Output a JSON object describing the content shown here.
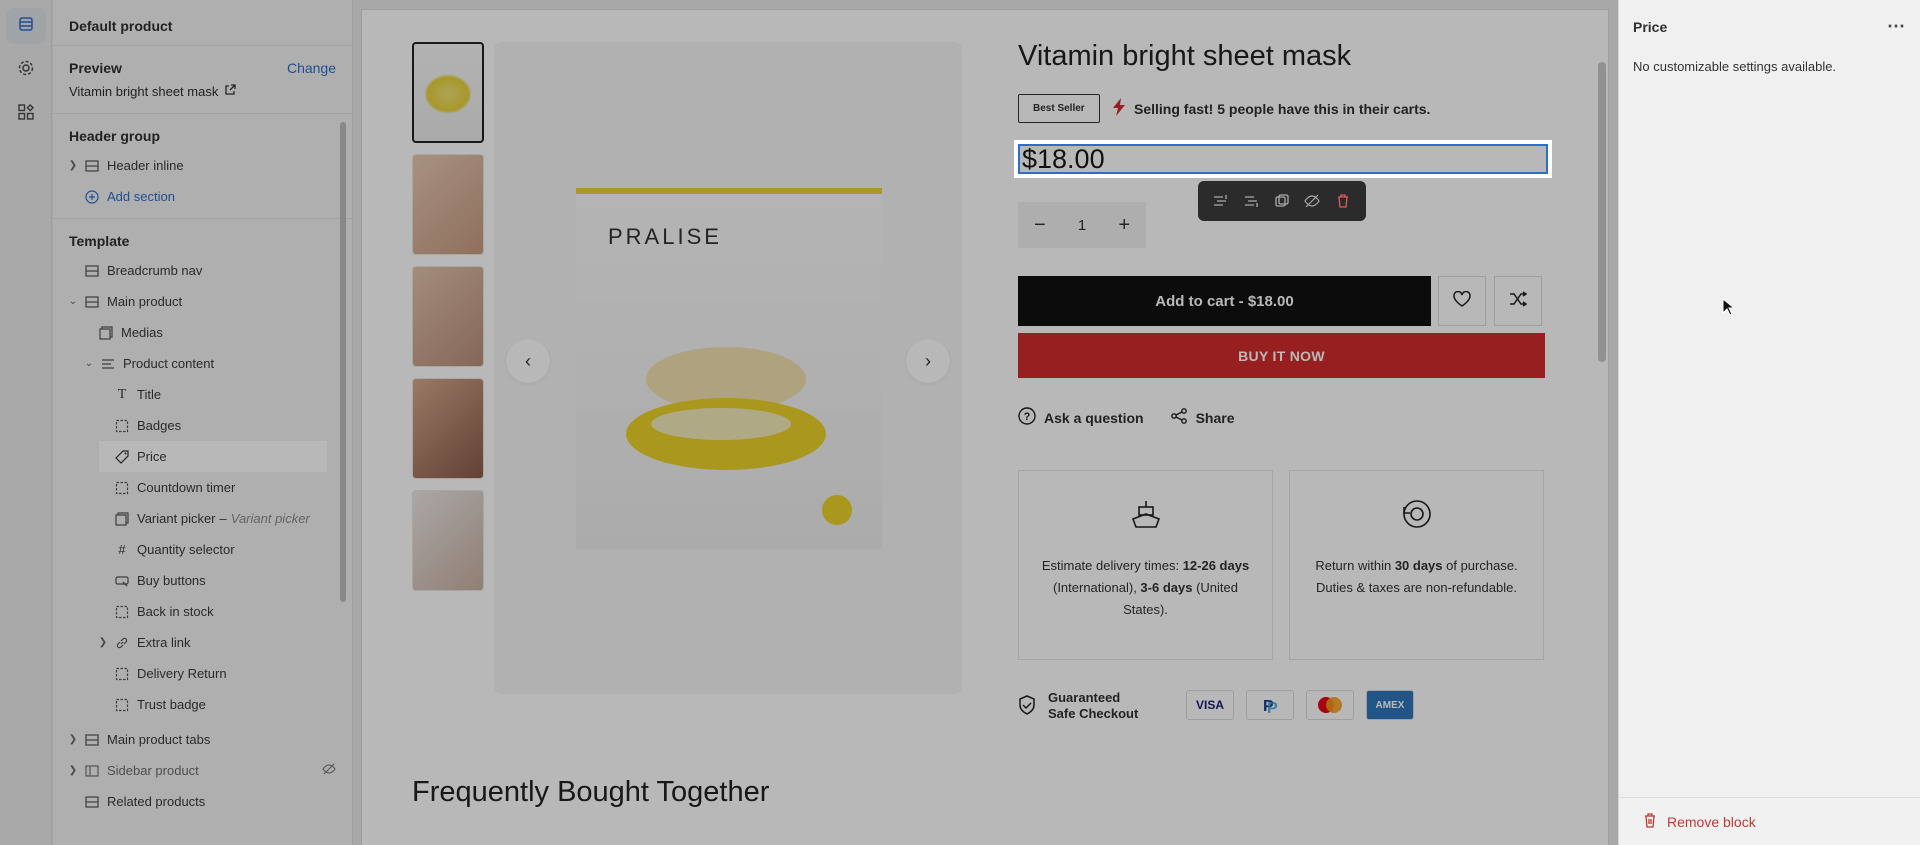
{
  "rail": {
    "items": [
      {
        "name": "sections-icon",
        "active": true
      },
      {
        "name": "settings-icon",
        "active": false
      },
      {
        "name": "apps-icon",
        "active": false
      }
    ]
  },
  "tree": {
    "header_title": "Default product",
    "preview": {
      "label": "Preview",
      "change_label": "Change",
      "product_name": "Vitamin bright sheet mask"
    },
    "header_group": {
      "title": "Header group",
      "items": [
        {
          "label": "Header inline"
        },
        {
          "label": "Add section"
        }
      ]
    },
    "template": {
      "title": "Template",
      "breadcrumb": "Breadcrumb nav",
      "main_product": "Main product",
      "medias": "Medias",
      "product_content": "Product content",
      "blocks": [
        {
          "label": "Title",
          "icon": "title-icon"
        },
        {
          "label": "Badges",
          "icon": "block-icon"
        },
        {
          "label": "Price",
          "icon": "price-tag-icon",
          "selected": true
        },
        {
          "label": "Countdown timer",
          "icon": "block-icon"
        },
        {
          "label": "Variant picker",
          "suffix": "Variant picker",
          "icon": "variant-icon"
        },
        {
          "label": "Quantity selector",
          "icon": "hash-icon"
        },
        {
          "label": "Buy buttons",
          "icon": "buy-icon"
        },
        {
          "label": "Back in stock",
          "icon": "block-icon"
        },
        {
          "label": "Extra link",
          "icon": "link-icon"
        },
        {
          "label": "Delivery Return",
          "icon": "block-icon"
        },
        {
          "label": "Trust badge",
          "icon": "block-icon"
        }
      ],
      "main_product_tabs": "Main product tabs",
      "sidebar_product": "Sidebar product",
      "related_products": "Related products"
    }
  },
  "product": {
    "title": "Vitamin bright sheet mask",
    "badge": "Best Seller",
    "urgency": "Selling fast! 5 people have this in their carts.",
    "price": "$18.00",
    "quantity": "1",
    "add_to_cart": "Add to cart",
    "add_to_cart_price": "$18.00",
    "add_to_cart_sep": " - ",
    "buy_now": "BUY IT NOW",
    "ask_question": "Ask a question",
    "share": "Share",
    "delivery": {
      "pre": "Estimate delivery times: ",
      "b1": "12-26 days",
      "mid": " (International), ",
      "b2": "3-6 days",
      "post": " (United States)."
    },
    "returns": {
      "pre": "Return within ",
      "b1": "30 days",
      "post": " of purchase. Duties & taxes are non-refundable."
    },
    "safe_checkout": "Guaranteed Safe Checkout",
    "payments": [
      "VISA",
      "PayPal",
      "Mastercard",
      "AMEX"
    ],
    "brand": "PRALISE",
    "frequently_bought": "Frequently Bought Together"
  },
  "settings_panel": {
    "title": "Price",
    "message": "No customizable settings available.",
    "remove_label": "Remove block"
  },
  "colors": {
    "accent": "#2c6ecb",
    "buy_now": "#d32c2c",
    "remove": "#c03838",
    "pack_yellow": "#e8d33a"
  }
}
